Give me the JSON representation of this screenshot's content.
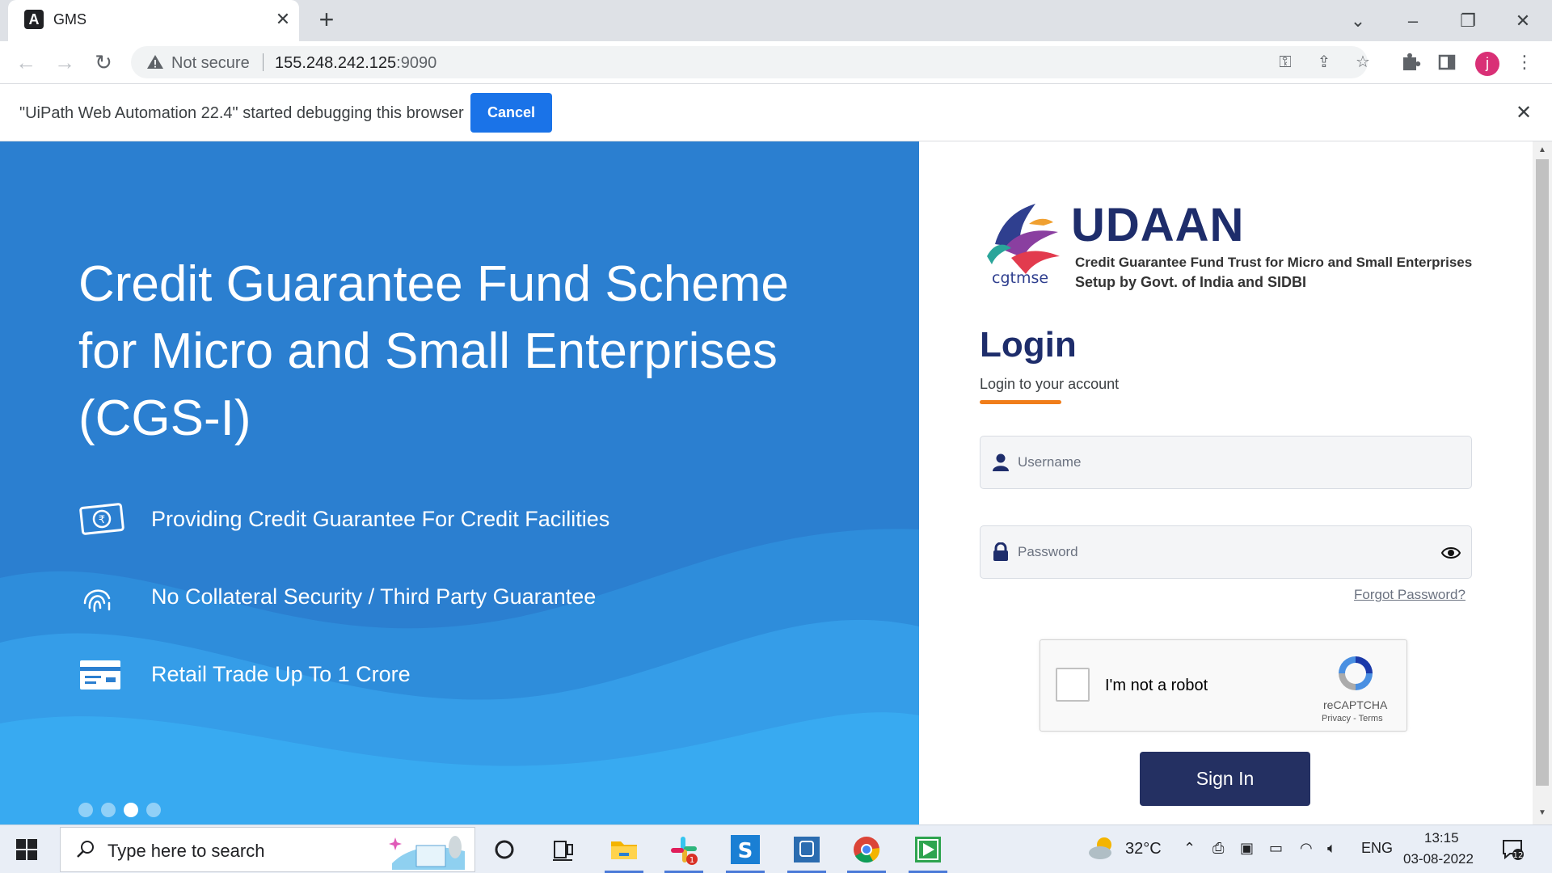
{
  "browser": {
    "tab_title": "GMS",
    "tab_favicon": "A",
    "url_secure_label": "Not secure",
    "url_host": "155.248.242.125",
    "url_port": ":9090",
    "profile_initial": "j"
  },
  "infobar": {
    "message": "\"UiPath Web Automation 22.4\" started debugging this browser",
    "cancel_label": "Cancel"
  },
  "hero": {
    "title": "Credit Guarantee Fund Scheme for Micro and Small Enterprises (CGS-I)",
    "features": [
      {
        "icon": "rupee-note-icon",
        "text": "Providing Credit Guarantee For Credit Facilities"
      },
      {
        "icon": "fingerprint-icon",
        "text": "No Collateral Security / Third Party Guarantee"
      },
      {
        "icon": "card-icon",
        "text": "Retail Trade Up To 1 Crore"
      }
    ],
    "carousel": {
      "count": 4,
      "active_index": 2
    },
    "colors": {
      "background": "#2b7fd0",
      "wave": "#3aa6ee"
    }
  },
  "login": {
    "logo_text": "cgtmse",
    "brand": "UDAAN",
    "brand_subtitle": "Credit Guarantee Fund Trust for Micro and Small Enterprises",
    "brand_tagline": "Setup by Govt. of India and SIDBI",
    "title": "Login",
    "subtitle": "Login to your account",
    "username_placeholder": "Username",
    "password_placeholder": "Password",
    "forgot_label": "Forgot Password?",
    "captcha_label": "I'm not a robot",
    "captcha_brand": "reCAPTCHA",
    "captcha_links": "Privacy - Terms",
    "signin_label": "Sign In",
    "colors": {
      "brand": "#1e2d6b",
      "accent": "#f07d1a",
      "button": "#243062"
    }
  },
  "taskbar": {
    "search_placeholder": "Type here to search",
    "weather": "32°C",
    "language": "ENG",
    "time": "13:15",
    "date": "03-08-2022",
    "notification_count": "12",
    "slack_badge": "1",
    "apps": [
      "cortana-icon",
      "task-view-icon",
      "file-explorer-icon",
      "slack-icon",
      "skype-icon",
      "app-icon",
      "chrome-icon",
      "uipath-icon"
    ]
  }
}
